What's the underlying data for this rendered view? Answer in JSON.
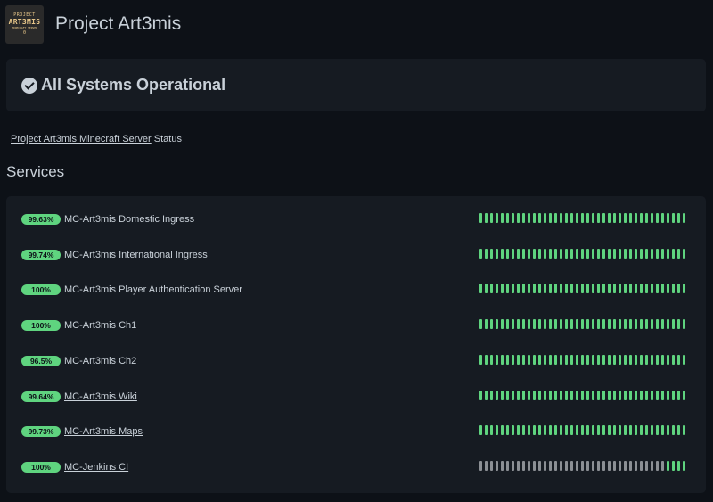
{
  "header": {
    "logo_lines": [
      "PROJECT",
      "ART3MIS",
      "MINECRAFT SERVER",
      "0"
    ],
    "title": "Project Art3mis"
  },
  "status": {
    "icon": "check-circle-icon",
    "text": "All Systems Operational"
  },
  "description": {
    "link_text": "Project Art3mis Minecraft Server",
    "suffix": " Status"
  },
  "services_heading": "Services",
  "colors": {
    "background": "#0d1117",
    "panel": "#161b22",
    "up": "#5fd47f",
    "no_data": "#8b8f94"
  },
  "services": [
    {
      "uptime": "99.63%",
      "name": "MC-Art3mis Domestic Ingress",
      "link": false,
      "no_data_days": 0
    },
    {
      "uptime": "99.74%",
      "name": "MC-Art3mis International Ingress",
      "link": false,
      "no_data_days": 0
    },
    {
      "uptime": "100%",
      "name": "MC-Art3mis Player Authentication Server",
      "link": false,
      "no_data_days": 0
    },
    {
      "uptime": "100%",
      "name": "MC-Art3mis Ch1",
      "link": false,
      "no_data_days": 0
    },
    {
      "uptime": "96.5%",
      "name": "MC-Art3mis Ch2",
      "link": false,
      "no_data_days": 0
    },
    {
      "uptime": "99.64%",
      "name": "MC-Art3mis Wiki",
      "link": true,
      "no_data_days": 0
    },
    {
      "uptime": "99.73%",
      "name": "MC-Art3mis Maps",
      "link": true,
      "no_data_days": 0
    },
    {
      "uptime": "100%",
      "name": "MC-Jenkins CI",
      "link": true,
      "no_data_days": 35
    }
  ],
  "days_per_service": 39
}
